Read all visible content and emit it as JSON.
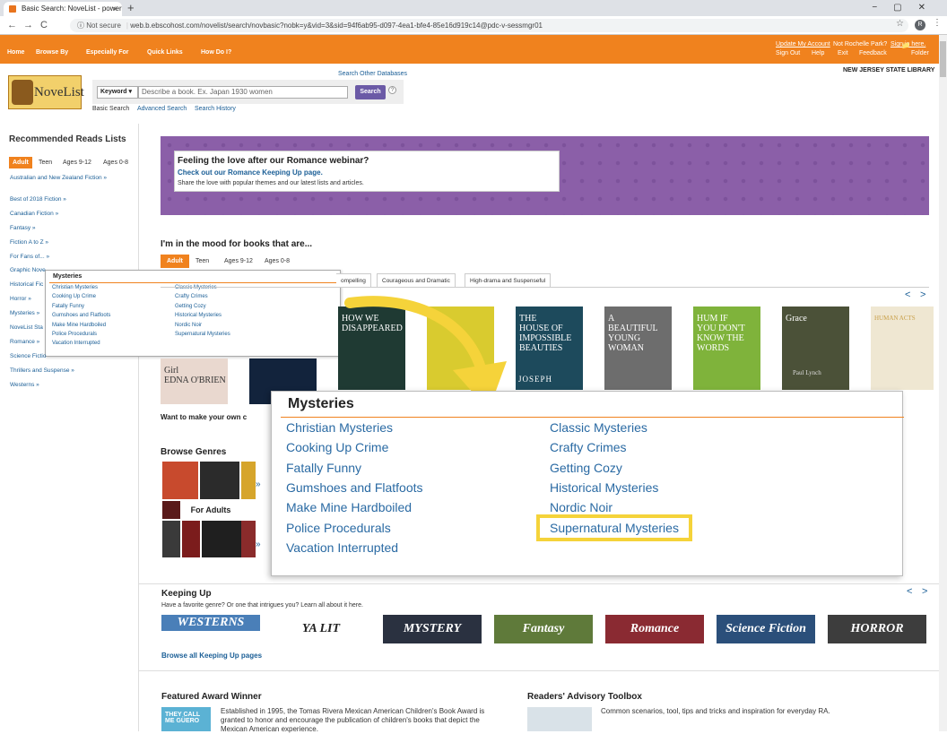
{
  "browser": {
    "tab_title": "Basic Search: NoveList - powere",
    "tab_close": "×",
    "new_tab": "+",
    "not_secure": "Not secure",
    "url": "web.b.ebscohost.com/novelist/search/novbasic?nobk=y&vid=3&sid=94f6ab95-d097-4ea1-bfe4-85e16d919c14@pdc-v-sessmgr01",
    "profile_initial": "R",
    "back": "←",
    "forward": "→",
    "reload": "C",
    "info": "ⓘ",
    "star": "☆",
    "kebab": "⋮",
    "win_controls": "−▢✕"
  },
  "topnav": {
    "items": [
      "Home",
      "Browse By",
      "Especially For",
      "Quick Links",
      "How Do I?"
    ],
    "update_account": "Update My Account",
    "not_user": "Not Rochelle Park?",
    "sign_in_here": "Sign in here.",
    "sign_out": "Sign Out",
    "help": "Help",
    "exit": "Exit",
    "feedback": "Feedback",
    "folder": "Folder"
  },
  "header": {
    "logo_text": "NoveList",
    "search_other": "Search Other Databases",
    "keyword_select": "Keyword ▾",
    "search_placeholder": "Describe a book. Ex. Japan 1930 women",
    "search_button": "Search",
    "help": "?",
    "basic_search": "Basic Search",
    "advanced_search": "Advanced Search",
    "search_history": "Search History",
    "library": "NEW JERSEY STATE LIBRARY"
  },
  "sidebar": {
    "title": "Recommended Reads Lists",
    "tabs": [
      "Adult",
      "Teen",
      "Ages 9-12",
      "Ages 0-8"
    ],
    "items": [
      "Australian and New Zealand Fiction »",
      "Best of 2018 Fiction »",
      "Canadian Fiction »",
      "Fantasy »",
      "Fiction A to Z »",
      "For Fans of... »",
      "Graphic Nove",
      "Historical Fic",
      "Horror »",
      "Mysteries »",
      "NoveList Sta",
      "Romance »",
      "Science Fictio",
      "Thrillers and Suspense »",
      "Westerns »"
    ]
  },
  "mini_popup": {
    "title": "Mysteries",
    "left": [
      "Christian Mysteries",
      "Cooking Up Crime",
      "Fatally Funny",
      "Gumshoes and Flatfoots",
      "Make Mine Hardboiled",
      "Police Procedurals",
      "Vacation Interrupted"
    ],
    "right": [
      "Classic Mysteries",
      "Crafty Crimes",
      "Getting Cozy",
      "Historical Mysteries",
      "Nordic Noir",
      "Supernatural Mysteries"
    ]
  },
  "banner": {
    "heading": "Feeling the love after our Romance webinar?",
    "link": "Check out our Romance Keeping Up page.",
    "sub": "Share the love with popular themes and our latest lists and articles."
  },
  "mood": {
    "title": "I'm in the mood for books that are...",
    "tabs": [
      "Adult",
      "Teen",
      "Ages 9-12",
      "Ages 0-8"
    ],
    "subtabs": [
      "ompelling",
      "Courageous and Dramatic",
      "High-drama and Suspenseful"
    ],
    "prev": "<",
    "next": ">"
  },
  "covers": [
    {
      "text": "Girl\nEDNA O'BRIEN",
      "color": "#e9d8cf"
    },
    {
      "text": "",
      "color": "#12233c"
    },
    {
      "text": "HOW WE\nDISAPPEARED",
      "color": "#1f3a33"
    },
    {
      "text": "",
      "color": "#d9cb2f"
    },
    {
      "text": "THE\nHOUSE OF\nIMPOSSIBLE\nBEAUTIES",
      "color": "#1d4a5c"
    },
    {
      "text": "A\nBEAUTIFUL\nYOUNG\nWOMAN",
      "color": "#6d6d6d"
    },
    {
      "text": "HUM IF\nYOU DON'T\nKNOW THE\nWORDS",
      "color": "#7fb33b"
    },
    {
      "text": "Grace",
      "color": "#4b5138"
    },
    {
      "text": "HUMAN ACTS",
      "color": "#efe7d2"
    }
  ],
  "cover_authors": [
    "JOSEPH",
    "Paul Lynch"
  ],
  "want_text": "Want to make your own c",
  "big_popup": {
    "title": "Mysteries",
    "left": [
      "Christian Mysteries",
      "Cooking Up Crime",
      "Fatally Funny",
      "Gumshoes and Flatfoots",
      "Make Mine Hardboiled",
      "Police Procedurals",
      "Vacation Interrupted"
    ],
    "right": [
      "Classic Mysteries",
      "Crafty Crimes",
      "Getting Cozy",
      "Historical Mysteries",
      "Nordic Noir",
      "Supernatural Mysteries"
    ],
    "highlighted": "Supernatural Mysteries"
  },
  "genres": {
    "title": "Browse Genres",
    "for_adults": "For Adults",
    "chevron": "»"
  },
  "keeping_up": {
    "title": "Keeping Up",
    "sub": "Have a favorite genre? Or one that intrigues you? Learn all about it here.",
    "tiles": [
      "WESTERNS",
      "YA LIT",
      "MYSTERY",
      "Fantasy",
      "Romance",
      "Science Fiction",
      "HORROR"
    ],
    "browse_all": "Browse all Keeping Up pages",
    "prev": "<",
    "next": ">"
  },
  "featured": {
    "title": "Featured Award Winner",
    "text": "Established in 1995, the Tomas Rivera Mexican American Children's Book Award is granted to honor and encourage the publication of children's books that depict the Mexican American experience."
  },
  "toolbox": {
    "title": "Readers' Advisory Toolbox",
    "text": "Common scenarios, tool, tips and tricks and inspiration for everyday RA."
  }
}
